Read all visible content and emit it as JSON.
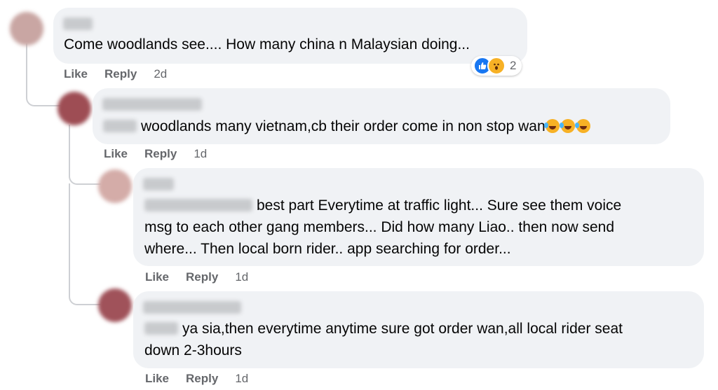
{
  "comments": [
    {
      "lines": [
        "Come woodlands see.... How many china n Malaysian doing..."
      ],
      "time": "2d",
      "reaction_count": "2"
    },
    {
      "lines": [
        "woodlands many vietnam,cb their order come in non stop wan"
      ],
      "time": "1d"
    },
    {
      "lines": [
        "best part Everytime at traffic light... Sure see them voice",
        "msg to each other gang members... Did how many Liao.. then now send",
        "where... Then local born rider.. app searching for order..."
      ],
      "time": "1d"
    },
    {
      "lines": [
        "ya sia,then everytime anytime sure got order wan,all local rider seat",
        "down 2-3hours"
      ],
      "time": "1d"
    }
  ],
  "actions": {
    "like": "Like",
    "reply": "Reply"
  },
  "icons": {
    "like_reaction": "thumbs-up-icon",
    "wow_reaction": "wow-face-icon",
    "laugh_emoji": "rofl-emoji-icon"
  },
  "colors": {
    "bubble": "#f0f2f5",
    "action_text": "#65676b",
    "like_blue": "#1877f2",
    "wow_yellow": "#f7b125"
  }
}
